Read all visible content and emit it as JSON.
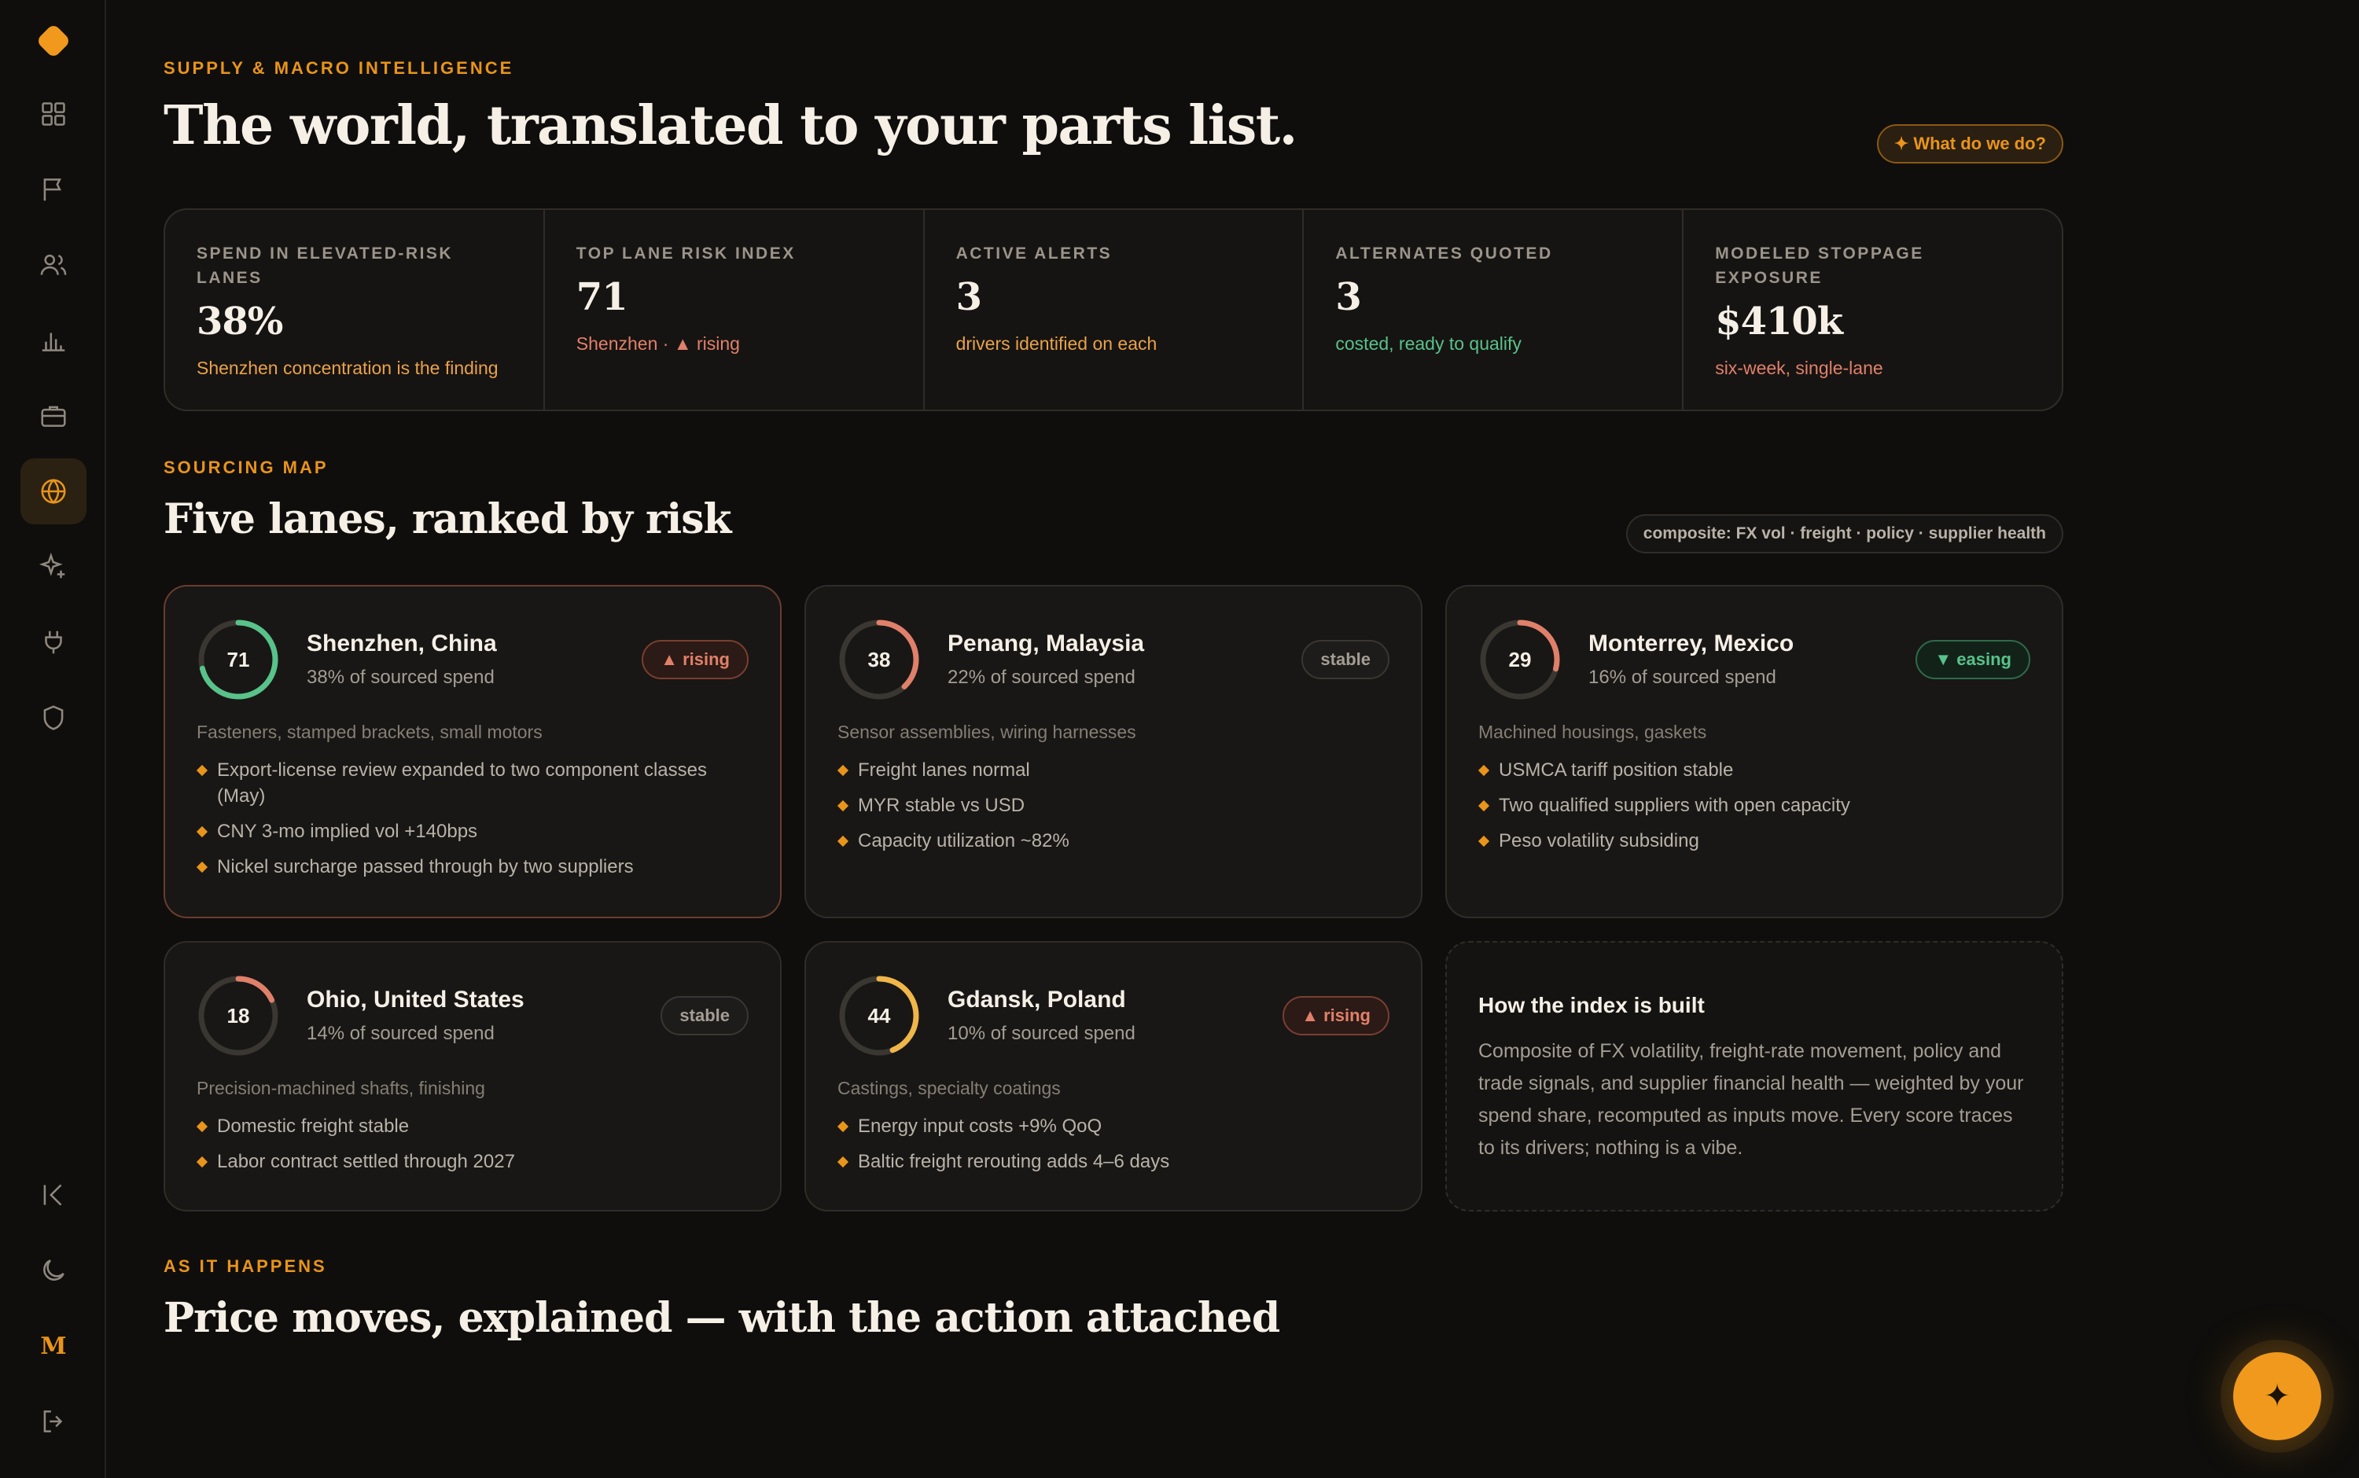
{
  "colors": {
    "accent": "#e9941a",
    "rising": "#e0806a",
    "easing": "#58c28a",
    "warm": "#e9a24a",
    "ring_track": "#3a3631"
  },
  "sidebar": {
    "items": [
      {
        "icon": "grid-icon"
      },
      {
        "icon": "flag-icon"
      },
      {
        "icon": "users-icon"
      },
      {
        "icon": "bar-chart-icon"
      },
      {
        "icon": "briefcase-icon"
      },
      {
        "icon": "globe-icon",
        "active": true
      },
      {
        "icon": "sparkles-icon"
      },
      {
        "icon": "plug-icon"
      },
      {
        "icon": "shield-icon"
      }
    ],
    "bottom": {
      "collapse_icon": "collapse-left-icon",
      "theme_icon": "moon-icon",
      "avatar_initial": "M",
      "logout_icon": "logout-icon"
    }
  },
  "header": {
    "eyebrow": "SUPPLY & MACRO INTELLIGENCE",
    "title": "The world, translated to your parts list.",
    "help_button": "✦ What do we do?"
  },
  "kpis": [
    {
      "label": "SPEND IN ELEVATED-RISK LANES",
      "value": "38%",
      "note": "Shenzhen concentration is the finding",
      "tone": "warm"
    },
    {
      "label": "TOP LANE RISK INDEX",
      "value": "71",
      "note": "Shenzhen · ▲ rising",
      "tone": "rising"
    },
    {
      "label": "ACTIVE ALERTS",
      "value": "3",
      "note": "drivers identified on each",
      "tone": "warm"
    },
    {
      "label": "ALTERNATES QUOTED",
      "value": "3",
      "note": "costed, ready to qualify",
      "tone": "easing"
    },
    {
      "label": "MODELED STOPPAGE EXPOSURE",
      "value": "$410k",
      "note": "six-week, single-lane",
      "tone": "rising"
    }
  ],
  "sourcing": {
    "eyebrow": "SOURCING MAP",
    "title": "Five lanes, ranked by risk",
    "composite_tag": "composite: FX vol · freight · policy · supplier health",
    "lanes": [
      {
        "name": "Shenzhen, China",
        "share": "38% of sourced spend",
        "score": 71,
        "badge": "▲ rising",
        "status": "rising",
        "ring_color": "#58c28a",
        "categories": "Fasteners, stamped brackets, small motors",
        "drivers": [
          "Export-license review expanded to two component classes (May)",
          "CNY 3-mo implied vol +140bps",
          "Nickel surcharge passed through by two suppliers"
        ]
      },
      {
        "name": "Penang, Malaysia",
        "share": "22% of sourced spend",
        "score": 38,
        "badge": "stable",
        "status": "stable",
        "ring_color": "#e0806a",
        "categories": "Sensor assemblies, wiring harnesses",
        "drivers": [
          "Freight lanes normal",
          "MYR stable vs USD",
          "Capacity utilization ~82%"
        ]
      },
      {
        "name": "Monterrey, Mexico",
        "share": "16% of sourced spend",
        "score": 29,
        "badge": "▼ easing",
        "status": "easing",
        "ring_color": "#e0806a",
        "categories": "Machined housings, gaskets",
        "drivers": [
          "USMCA tariff position stable",
          "Two qualified suppliers with open capacity",
          "Peso volatility subsiding"
        ]
      },
      {
        "name": "Ohio, United States",
        "share": "14% of sourced spend",
        "score": 18,
        "badge": "stable",
        "status": "stable",
        "ring_color": "#e0806a",
        "categories": "Precision-machined shafts, finishing",
        "drivers": [
          "Domestic freight stable",
          "Labor contract settled through 2027"
        ]
      },
      {
        "name": "Gdansk, Poland",
        "share": "10% of sourced spend",
        "score": 44,
        "badge": "▲ rising",
        "status": "rising",
        "ring_color": "#f0b64a",
        "categories": "Castings, specialty coatings",
        "drivers": [
          "Energy input costs +9% QoQ",
          "Baltic freight rerouting adds 4–6 days"
        ]
      }
    ],
    "index_info": {
      "title": "How the index is built",
      "body": "Composite of FX volatility, freight-rate movement, policy and trade signals, and supplier financial health — weighted by your spend share, recomputed as inputs move. Every score traces to its drivers; nothing is a vibe."
    }
  },
  "feed": {
    "eyebrow": "AS IT HAPPENS",
    "title": "Price moves, explained — with the action attached"
  },
  "fab": {
    "icon": "sparkle-icon",
    "glyph": "✦"
  }
}
